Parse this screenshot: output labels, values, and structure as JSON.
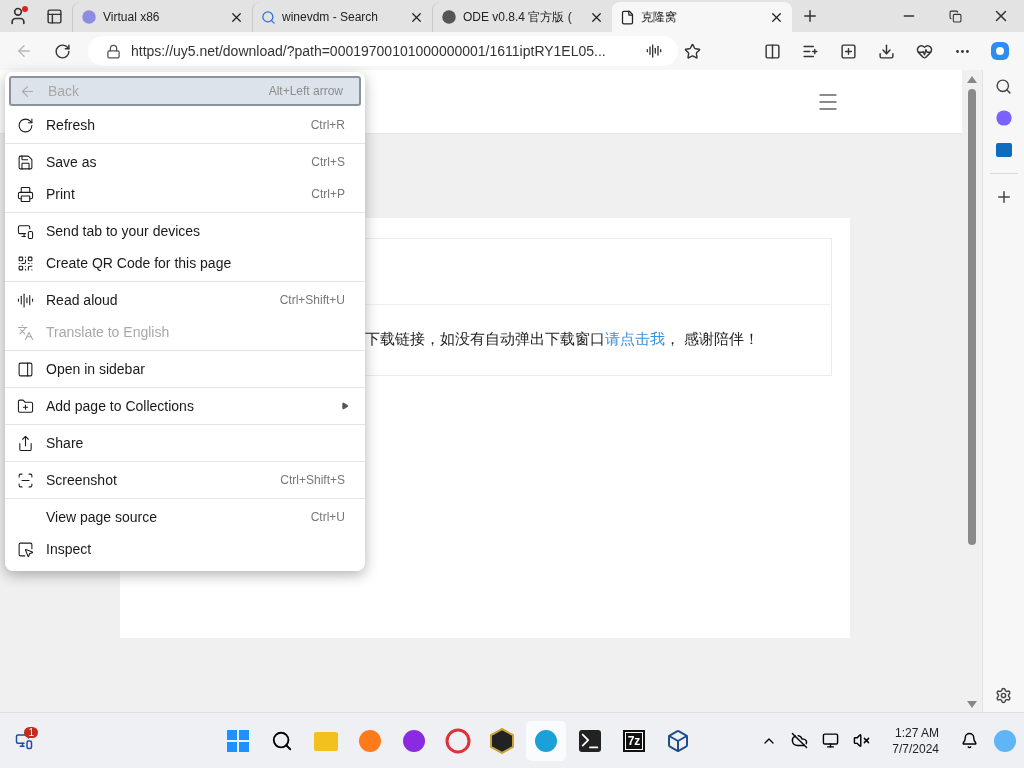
{
  "browser": {
    "tabs": [
      {
        "title": "Virtual x86",
        "selected": false
      },
      {
        "title": "winevdm - Search",
        "selected": false
      },
      {
        "title": "ODE v0.8.4 官方版 (",
        "selected": false
      },
      {
        "title": "克隆窝",
        "selected": true
      }
    ],
    "address": {
      "url": "https://uy5.net/download/?path=00019700101000000001/1611iptRY1EL05..."
    }
  },
  "page": {
    "message": "下载链接，如没有自动弹出下载窗口",
    "link": "请点击我",
    "message_end": "， 感谢陪伴！"
  },
  "context_menu": {
    "sections": [
      {
        "items": [
          {
            "label": "Back",
            "shortcut": "Alt+Left arrow",
            "disabled": true,
            "selected": true,
            "submenu": false
          },
          {
            "label": "Refresh",
            "shortcut": "Ctrl+R",
            "disabled": false,
            "selected": false,
            "submenu": false
          }
        ]
      },
      {
        "items": [
          {
            "label": "Save as",
            "shortcut": "Ctrl+S",
            "disabled": false,
            "selected": false,
            "submenu": false
          },
          {
            "label": "Print",
            "shortcut": "Ctrl+P",
            "disabled": false,
            "selected": false,
            "submenu": false
          }
        ]
      },
      {
        "items": [
          {
            "label": "Send tab to your devices",
            "disabled": false,
            "selected": false,
            "submenu": false
          },
          {
            "label": "Create QR Code for this page",
            "disabled": false,
            "selected": false,
            "submenu": false
          }
        ]
      },
      {
        "items": [
          {
            "label": "Read aloud",
            "shortcut": "Ctrl+Shift+U",
            "disabled": false,
            "selected": false,
            "submenu": false
          },
          {
            "label": "Translate to English",
            "disabled": true,
            "selected": false,
            "submenu": false
          }
        ]
      },
      {
        "items": [
          {
            "label": "Open in sidebar",
            "disabled": false,
            "selected": false,
            "submenu": false
          }
        ]
      },
      {
        "items": [
          {
            "label": "Add page to Collections",
            "disabled": false,
            "selected": false,
            "submenu": true
          }
        ]
      },
      {
        "items": [
          {
            "label": "Share",
            "disabled": false,
            "selected": false,
            "submenu": false
          }
        ]
      },
      {
        "items": [
          {
            "label": "Screenshot",
            "shortcut": "Ctrl+Shift+S",
            "disabled": false,
            "selected": false,
            "submenu": false
          }
        ]
      },
      {
        "items": [
          {
            "label": "View page source",
            "shortcut": "Ctrl+U",
            "disabled": false,
            "selected": false,
            "submenu": false
          },
          {
            "label": "Inspect",
            "disabled": false,
            "selected": false,
            "submenu": false
          }
        ]
      }
    ]
  },
  "taskbar": {
    "badge": "1",
    "app_label": "7z",
    "time": "1:27 AM",
    "date": "7/7/2024"
  }
}
